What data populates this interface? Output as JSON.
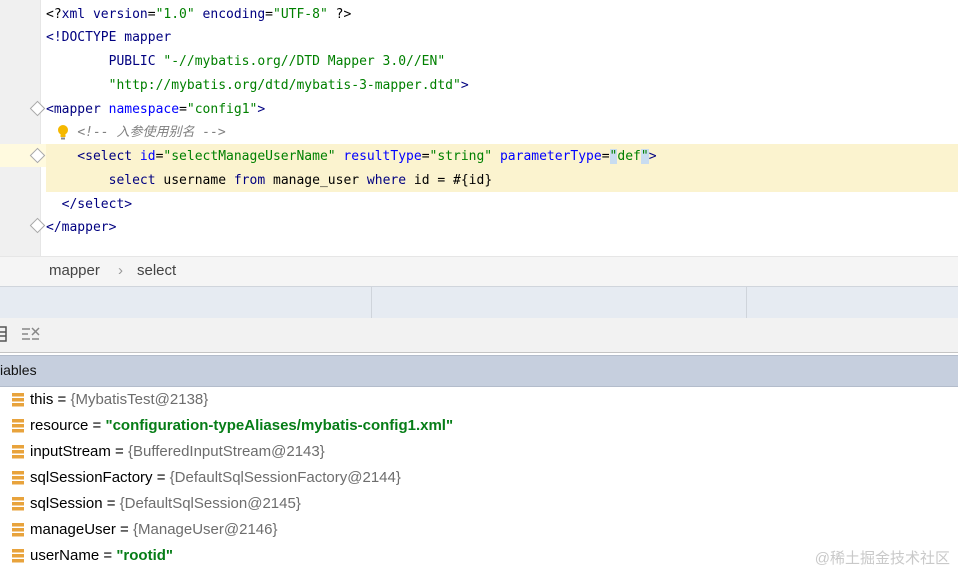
{
  "editor": {
    "lines": [
      [
        {
          "t": "<?",
          "c": "t-pi"
        },
        {
          "t": "xml version",
          "c": "t-kw"
        },
        {
          "t": "=",
          "c": "t-plain"
        },
        {
          "t": "\"1.0\"",
          "c": "t-str"
        },
        {
          "t": " encoding",
          "c": "t-kw"
        },
        {
          "t": "=",
          "c": "t-plain"
        },
        {
          "t": "\"UTF-8\"",
          "c": "t-str"
        },
        {
          "t": " ?>",
          "c": "t-pi"
        }
      ],
      [
        {
          "t": "<!DOCTYPE mapper",
          "c": "t-kw"
        }
      ],
      [
        {
          "t": "        PUBLIC ",
          "c": "t-kw"
        },
        {
          "t": "\"-//mybatis.org//DTD Mapper 3.0//EN\"",
          "c": "t-str"
        }
      ],
      [
        {
          "t": "        ",
          "c": "t-plain"
        },
        {
          "t": "\"http://mybatis.org/dtd/mybatis-3-mapper.dtd\"",
          "c": "t-str"
        },
        {
          "t": ">",
          "c": "t-kw"
        }
      ],
      [
        {
          "t": "<mapper ",
          "c": "t-tag"
        },
        {
          "t": "namespace",
          "c": "t-attr"
        },
        {
          "t": "=",
          "c": "t-plain"
        },
        {
          "t": "\"config1\"",
          "c": "t-str"
        },
        {
          "t": ">",
          "c": "t-tag"
        }
      ],
      [
        {
          "t": "    ",
          "c": "t-plain"
        },
        {
          "t": "<!-- 入参使用别名 -->",
          "c": "t-comment"
        }
      ],
      [
        {
          "t": "    <select ",
          "c": "t-tag"
        },
        {
          "t": "id",
          "c": "t-attr"
        },
        {
          "t": "=",
          "c": "t-plain"
        },
        {
          "t": "\"selectManageUserName\"",
          "c": "t-str"
        },
        {
          "t": " resultType",
          "c": "t-attr"
        },
        {
          "t": "=",
          "c": "t-plain"
        },
        {
          "t": "\"string\"",
          "c": "t-str"
        },
        {
          "t": " parameterType",
          "c": "t-attr"
        },
        {
          "t": "=",
          "c": "t-plain"
        },
        {
          "t": "\"",
          "c": "t-str caret-box"
        },
        {
          "t": "def",
          "c": "t-str"
        },
        {
          "t": "\"",
          "c": "t-str caret-box"
        },
        {
          "t": ">",
          "c": "t-tag"
        }
      ],
      [
        {
          "t": "        select ",
          "c": "t-sqlkw"
        },
        {
          "t": "username ",
          "c": "t-plain"
        },
        {
          "t": "from ",
          "c": "t-sqlkw"
        },
        {
          "t": "manage_user ",
          "c": "t-plain"
        },
        {
          "t": "where ",
          "c": "t-sqlkw"
        },
        {
          "t": "id = #{id}",
          "c": "t-plain"
        }
      ],
      [
        {
          "t": "  </select>",
          "c": "t-tag"
        }
      ],
      [
        {
          "t": "</mapper>",
          "c": "t-tag"
        }
      ]
    ]
  },
  "breadcrumb": {
    "item1": "mapper",
    "separator": "›",
    "item2": "select"
  },
  "variables": {
    "header": "iables",
    "rows": [
      {
        "name": "this",
        "eq": " = ",
        "value": "{MybatisTest@2138}",
        "kind": "obj"
      },
      {
        "name": "resource",
        "eq": " = ",
        "value": "\"configuration-typeAliases/mybatis-config1.xml\"",
        "kind": "str"
      },
      {
        "name": "inputStream",
        "eq": " = ",
        "value": "{BufferedInputStream@2143}",
        "kind": "obj"
      },
      {
        "name": "sqlSessionFactory",
        "eq": " = ",
        "value": "{DefaultSqlSessionFactory@2144}",
        "kind": "obj"
      },
      {
        "name": "sqlSession",
        "eq": " = ",
        "value": "{DefaultSqlSession@2145}",
        "kind": "obj"
      },
      {
        "name": "manageUser",
        "eq": " = ",
        "value": "{ManageUser@2146}",
        "kind": "obj"
      },
      {
        "name": "userName",
        "eq": " = ",
        "value": "\"rootid\"",
        "kind": "str"
      }
    ]
  },
  "watermark": "@稀土掘金技术社区",
  "colors": {
    "accent_highlight": "#fbf3cf",
    "string_value": "#067d17",
    "header_bg": "#c6cfde"
  }
}
